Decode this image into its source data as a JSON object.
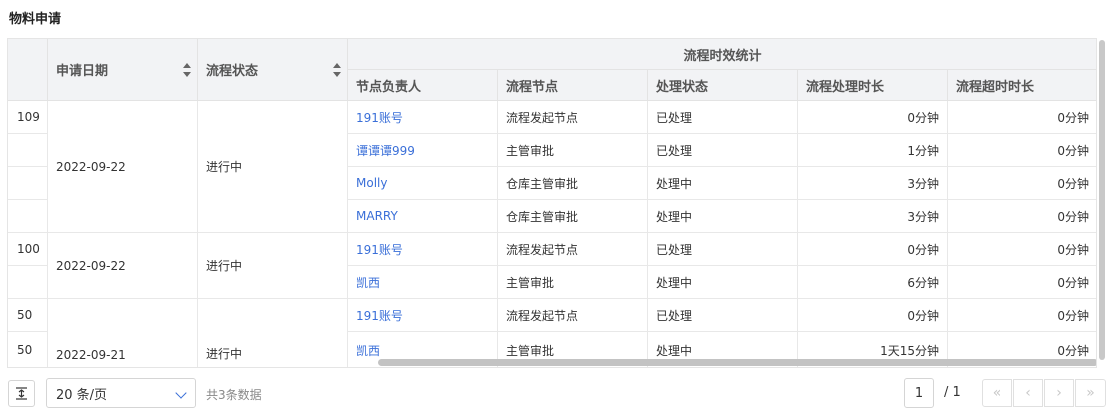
{
  "page": {
    "title": "物料申请"
  },
  "table": {
    "group_header": "流程时效统计",
    "headers": {
      "apply_date": "申请日期",
      "flow_status": "流程状态",
      "node_owner": "节点负责人",
      "flow_node": "流程节点",
      "handle_status": "处理状态",
      "handle_duration": "流程处理时长",
      "overtime_duration": "流程超时时长"
    },
    "groups": [
      {
        "apply_date": "2022-09-22",
        "flow_status": "进行中",
        "rows": [
          {
            "idx": "109",
            "owner": "191账号",
            "node": "流程发起节点",
            "status": "已处理",
            "duration": "0分钟",
            "overtime": "0分钟"
          },
          {
            "idx": "",
            "owner": "谭谭谭999",
            "node": "主管审批",
            "status": "已处理",
            "duration": "1分钟",
            "overtime": "0分钟"
          },
          {
            "idx": "",
            "owner": "Molly",
            "node": "仓库主管审批",
            "status": "处理中",
            "duration": "3分钟",
            "overtime": "0分钟"
          },
          {
            "idx": "",
            "owner": "MARRY",
            "node": "仓库主管审批",
            "status": "处理中",
            "duration": "3分钟",
            "overtime": "0分钟"
          }
        ]
      },
      {
        "apply_date": "2022-09-22",
        "flow_status": "进行中",
        "rows": [
          {
            "idx": "100",
            "owner": "191账号",
            "node": "流程发起节点",
            "status": "已处理",
            "duration": "0分钟",
            "overtime": "0分钟"
          },
          {
            "idx": "",
            "owner": "凯西",
            "node": "主管审批",
            "status": "处理中",
            "duration": "6分钟",
            "overtime": "0分钟"
          }
        ]
      },
      {
        "apply_date": "2022-09-21",
        "flow_status": "进行中",
        "rows": [
          {
            "idx": "50",
            "owner": "191账号",
            "node": "流程发起节点",
            "status": "已处理",
            "duration": "0分钟",
            "overtime": "0分钟"
          },
          {
            "idx": "50",
            "owner": "凯西",
            "node": "主管审批",
            "status": "处理中",
            "duration": "1天15分钟",
            "overtime": "0分钟"
          }
        ]
      }
    ]
  },
  "pagination": {
    "page_size": "20 条/页",
    "total_text": "共3条数据",
    "current_page": "1",
    "total_pages": "/ 1"
  },
  "colors": {
    "link": "#3a6fd8",
    "header_bg": "#f2f3f5"
  },
  "icons": {
    "expand": "vertical-expand-icon",
    "sort": "sort-icon",
    "chevron": "chevron-down-icon",
    "first": "double-chevron-left-icon",
    "prev": "chevron-left-icon",
    "next": "chevron-right-icon",
    "last": "double-chevron-right-icon"
  }
}
